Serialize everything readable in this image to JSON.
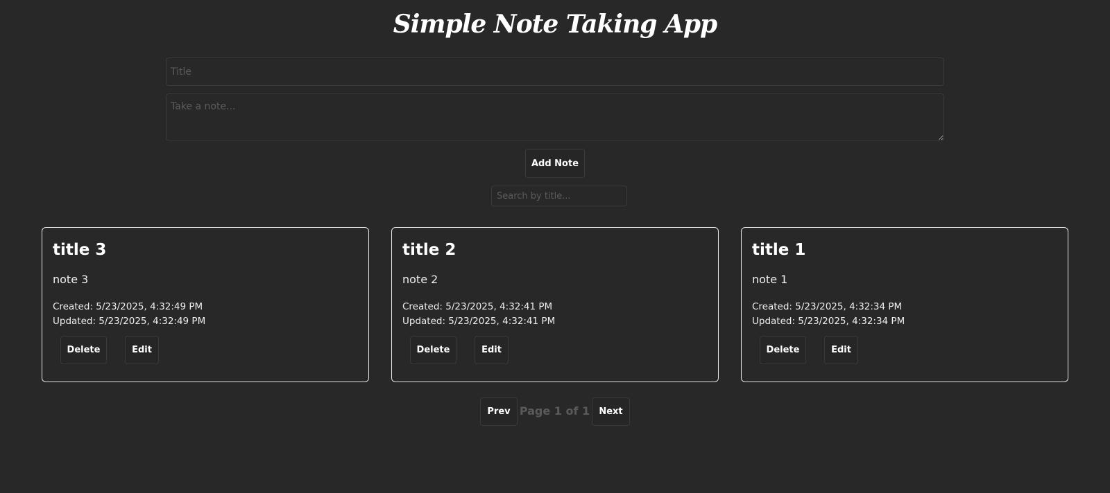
{
  "app": {
    "title": "Simple Note Taking App"
  },
  "form": {
    "title_placeholder": "Title",
    "title_value": "",
    "note_placeholder": "Take a note...",
    "note_value": "",
    "add_label": "Add Note"
  },
  "search": {
    "placeholder": "Search by title...",
    "value": ""
  },
  "notes": [
    {
      "title": "title 3",
      "body": "note 3",
      "created": "Created: 5/23/2025, 4:32:49 PM",
      "updated": "Updated: 5/23/2025, 4:32:49 PM",
      "delete_label": "Delete",
      "edit_label": "Edit"
    },
    {
      "title": "title 2",
      "body": "note 2",
      "created": "Created: 5/23/2025, 4:32:41 PM",
      "updated": "Updated: 5/23/2025, 4:32:41 PM",
      "delete_label": "Delete",
      "edit_label": "Edit"
    },
    {
      "title": "title 1",
      "body": "note 1",
      "created": "Created: 5/23/2025, 4:32:34 PM",
      "updated": "Updated: 5/23/2025, 4:32:34 PM",
      "delete_label": "Delete",
      "edit_label": "Edit"
    }
  ],
  "pagination": {
    "prev_label": "Prev",
    "page_text": "Page 1 of 1",
    "next_label": "Next"
  },
  "colors": {
    "background": "#282828",
    "card_border": "#e6e6e6",
    "text": "#ffffff",
    "muted_text": "#5a5a5a"
  }
}
